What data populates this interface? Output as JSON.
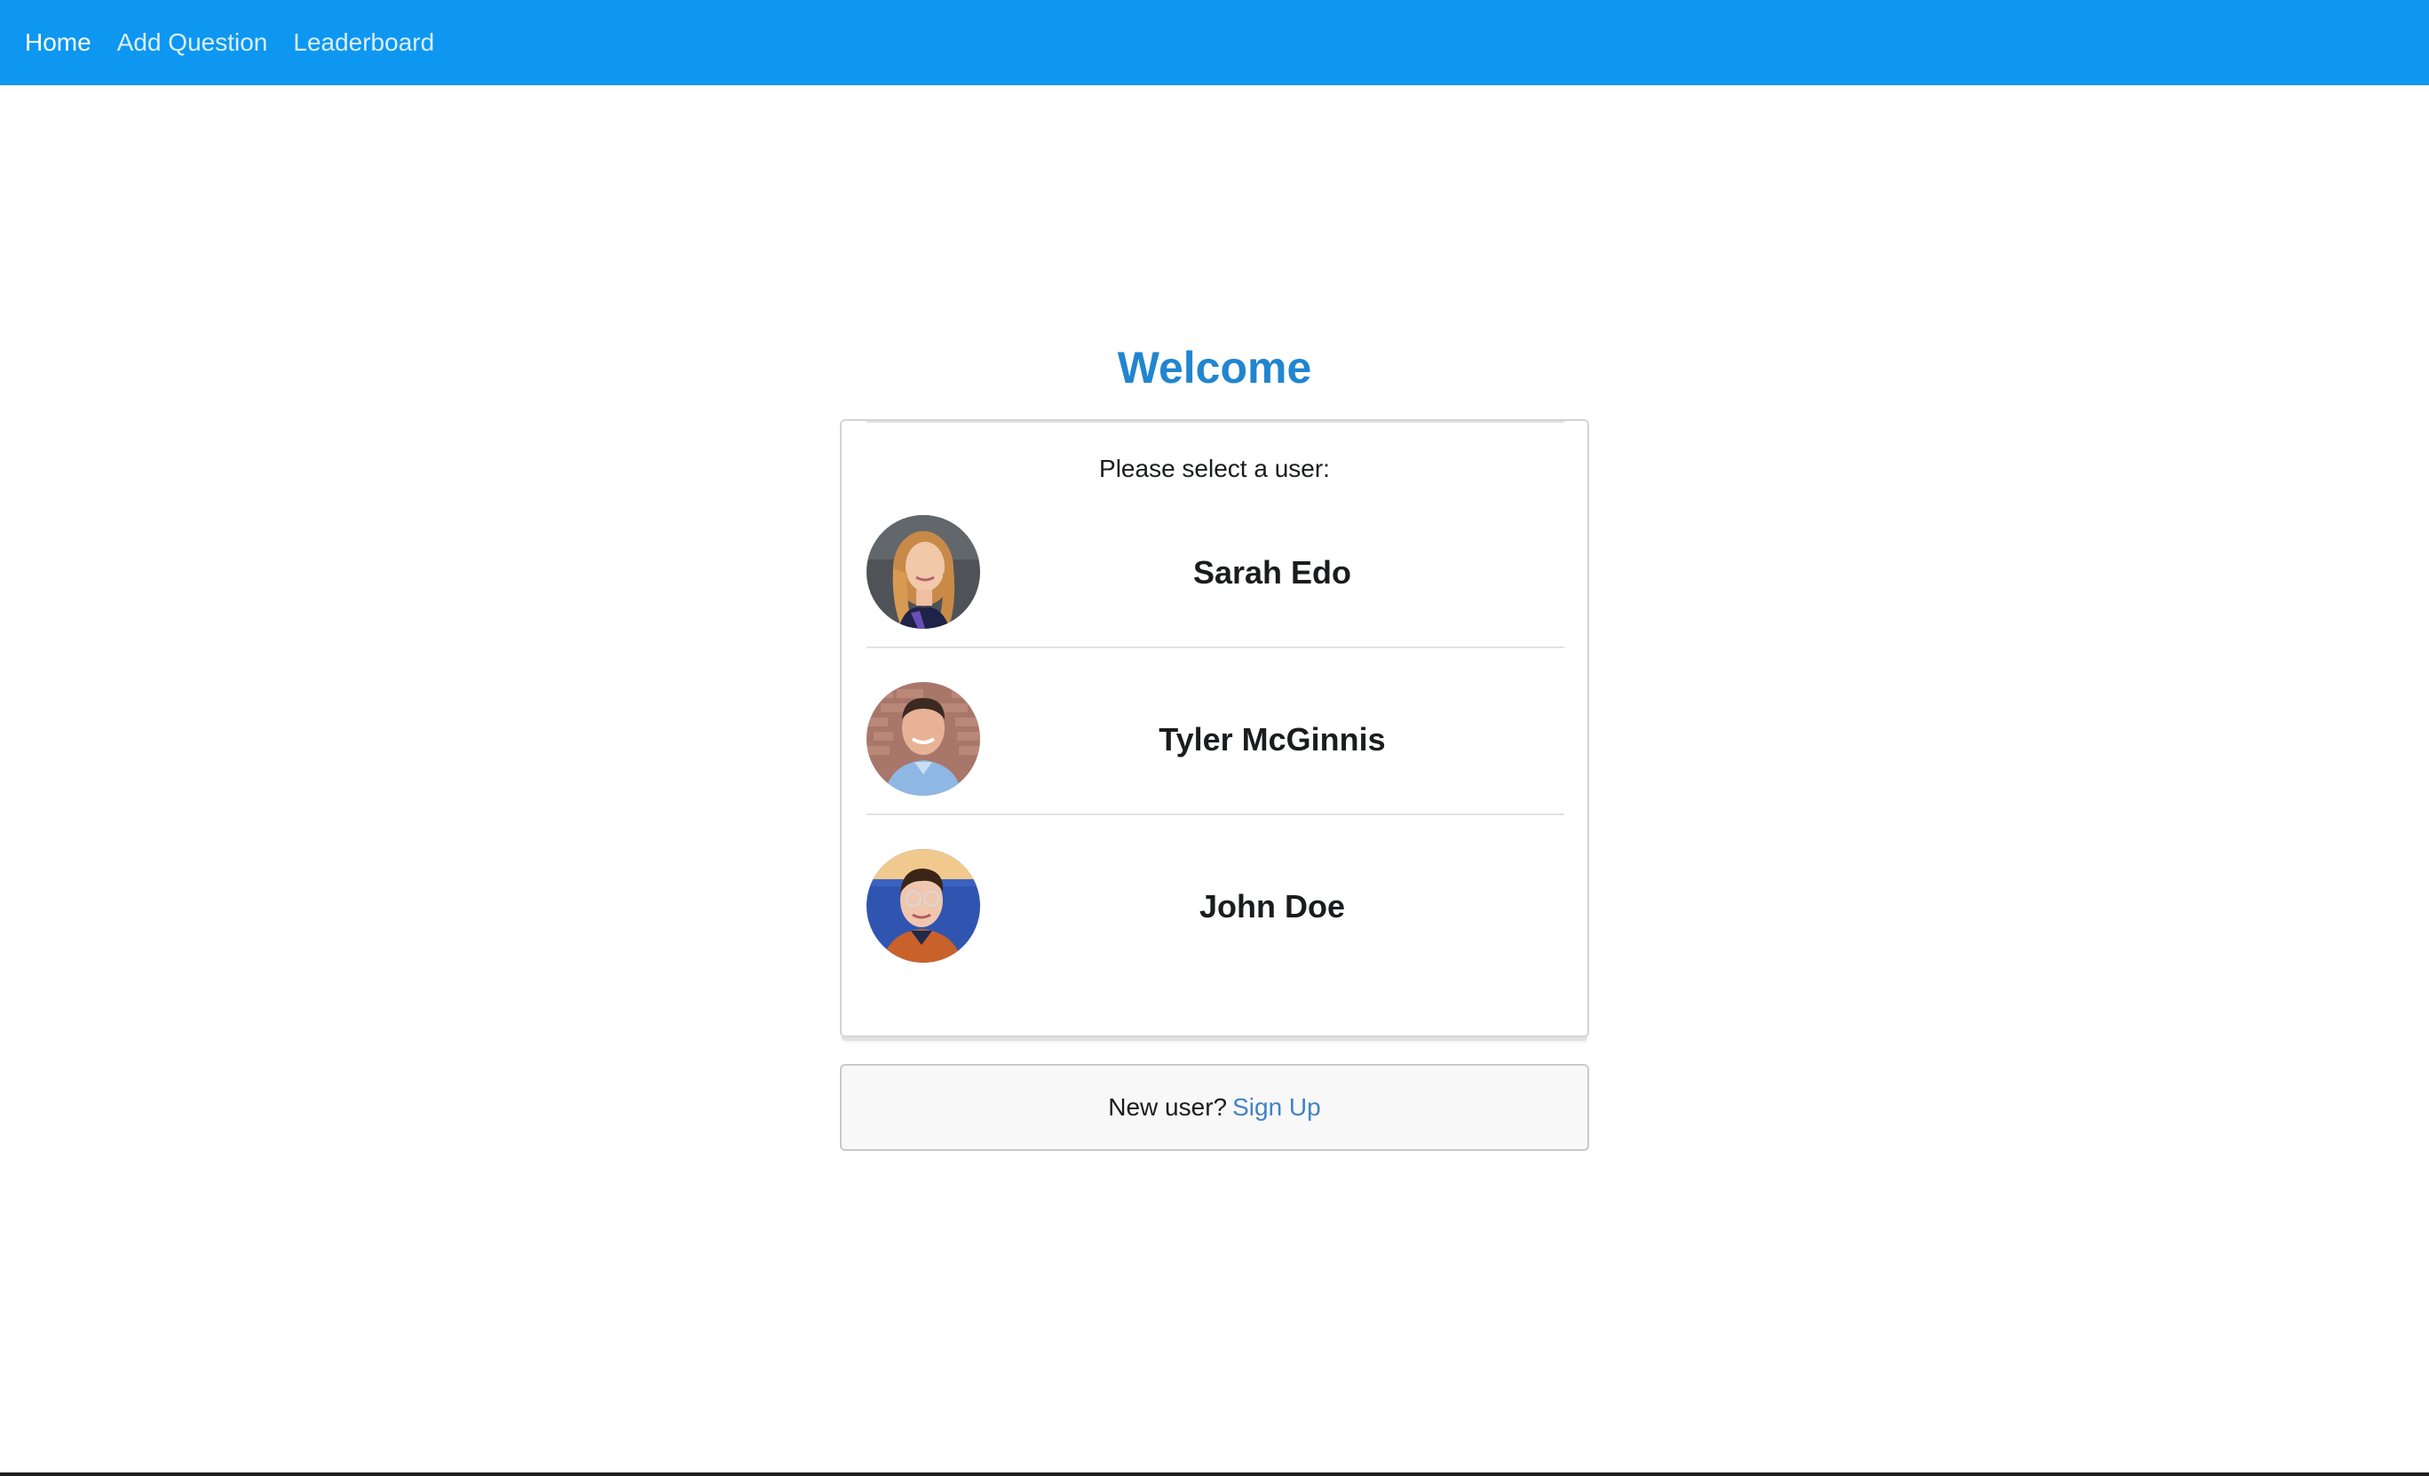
{
  "nav": {
    "items": [
      {
        "label": "Home",
        "active": true
      },
      {
        "label": "Add Question",
        "active": false
      },
      {
        "label": "Leaderboard",
        "active": false
      }
    ],
    "background_color": "#0d97f0"
  },
  "main": {
    "title": "Welcome",
    "title_color": "#2185d0",
    "card": {
      "prompt": "Please select a user:",
      "users": [
        {
          "name": "Sarah Edo",
          "avatar_icon": "avatar-woman-blonde"
        },
        {
          "name": "Tyler McGinnis",
          "avatar_icon": "avatar-man-brick-wall"
        },
        {
          "name": "John Doe",
          "avatar_icon": "avatar-man-glasses"
        }
      ]
    },
    "signup": {
      "text": "New user?",
      "link_label": "Sign Up",
      "link_color": "#4183c4"
    }
  }
}
